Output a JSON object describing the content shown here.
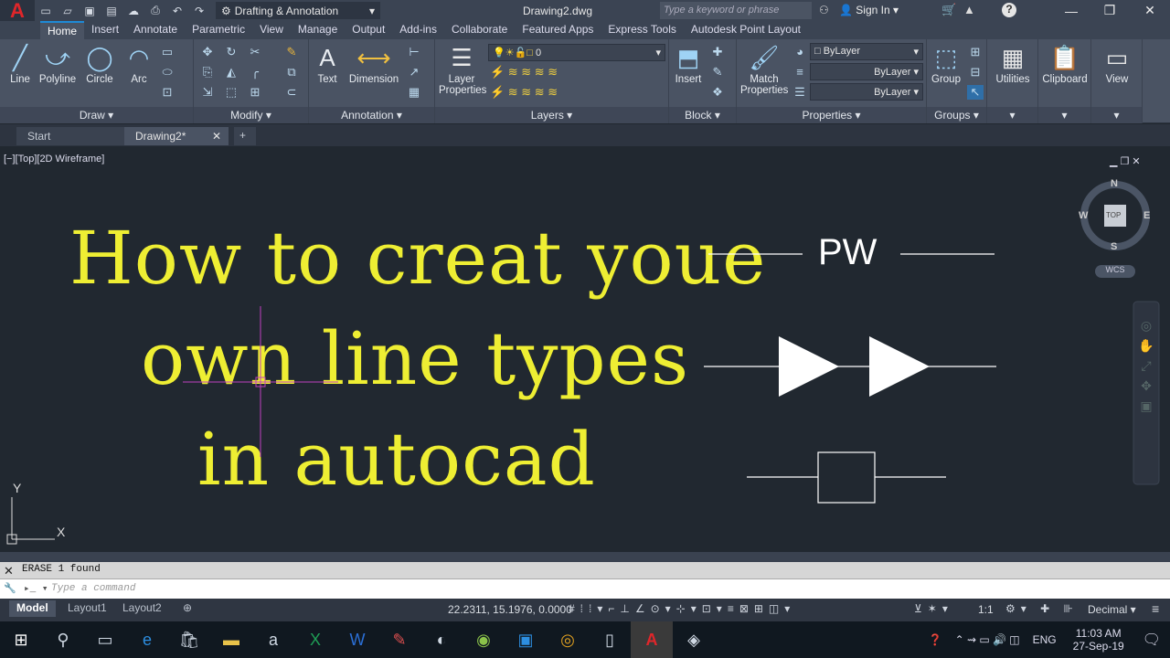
{
  "app": {
    "logo": "A",
    "workspace": "Drafting & Annotation",
    "document_title": "Drawing2.dwg",
    "search_placeholder": "Type a keyword or phrase",
    "sign_in": "Sign In"
  },
  "ribbon_tabs": [
    "Home",
    "Insert",
    "Annotate",
    "Parametric",
    "View",
    "Manage",
    "Output",
    "Add-ins",
    "Collaborate",
    "Featured Apps",
    "Express Tools",
    "Autodesk Point Layout"
  ],
  "ribbon": {
    "draw": {
      "title": "Draw",
      "line": "Line",
      "polyline": "Polyline",
      "circle": "Circle",
      "arc": "Arc"
    },
    "modify": {
      "title": "Modify"
    },
    "annotation": {
      "title": "Annotation",
      "text": "Text",
      "dimension": "Dimension"
    },
    "layers": {
      "title": "Layers",
      "layer_properties_1": "Layer",
      "layer_properties_2": "Properties",
      "current_layer": "0"
    },
    "block": {
      "title": "Block",
      "insert": "Insert"
    },
    "properties": {
      "title": "Properties",
      "match_1": "Match",
      "match_2": "Properties",
      "color": "ByLayer",
      "linetype": "ByLayer",
      "lineweight": "ByLayer"
    },
    "groups": {
      "title": "Groups",
      "group": "Group"
    },
    "utilities": "Utilities",
    "clipboard": "Clipboard",
    "view": "View"
  },
  "doc_tabs": {
    "start": "Start",
    "drawing": "Drawing2*"
  },
  "viewport": {
    "label": "[−][Top][2D Wireframe]",
    "headline": [
      "How to creat youe",
      "own line types",
      "in autocad"
    ],
    "pw_text": "PW",
    "viewcube": {
      "n": "N",
      "s": "S",
      "e": "E",
      "w": "W",
      "top": "TOP",
      "wcs": "WCS"
    },
    "ucs_x": "X",
    "ucs_y": "Y"
  },
  "command": {
    "history": "ERASE 1 found",
    "placeholder": "Type a command"
  },
  "layout_tabs": [
    "Model",
    "Layout1",
    "Layout2"
  ],
  "status": {
    "coords": "22.2311, 15.1976, 0.0000",
    "scale": "1:1",
    "units": "Decimal"
  },
  "taskbar": {
    "lang": "ENG",
    "time": "11:03 AM",
    "date": "27-Sep-19"
  },
  "colors": {
    "accent": "#1e8ad6",
    "headline": "#eeee33",
    "viewport_bg": "#212830"
  }
}
